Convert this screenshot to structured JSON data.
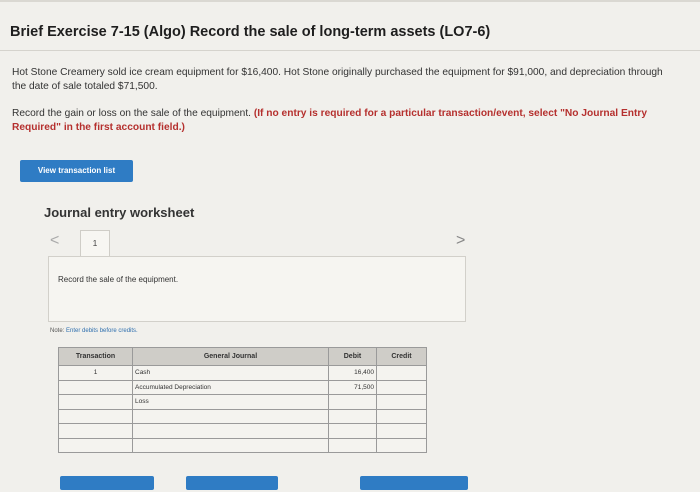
{
  "page": {
    "title": "Brief Exercise 7-15 (Algo) Record the sale of long-term assets (LO7-6)",
    "description": "Hot Stone Creamery sold ice cream equipment for $16,400. Hot Stone originally purchased the equipment for $91,000, and depreciation through the date of sale totaled $71,500.",
    "instruction_plain": "Record the gain or loss on the sale of the equipment. ",
    "instruction_bold": "(If no entry is required for a particular transaction/event, select \"No Journal Entry Required\" in the first account field.)"
  },
  "buttons": {
    "view_transaction_list": "View transaction list"
  },
  "worksheet": {
    "title": "Journal entry worksheet",
    "prev_arrow": "<",
    "next_arrow": ">",
    "current_tab": "1",
    "record_text": "Record the sale of the equipment.",
    "note_label": "Note:",
    "note_text": "Enter debits before credits."
  },
  "journal": {
    "headers": {
      "transaction": "Transaction",
      "general_journal": "General Journal",
      "debit": "Debit",
      "credit": "Credit"
    },
    "rows": [
      {
        "transaction": "1",
        "account": "Cash",
        "debit": "16,400",
        "credit": ""
      },
      {
        "transaction": "",
        "account": "Accumulated Depreciation",
        "debit": "71,500",
        "credit": ""
      },
      {
        "transaction": "",
        "account": "Loss",
        "debit": "",
        "credit": ""
      },
      {
        "transaction": "",
        "account": "",
        "debit": "",
        "credit": ""
      },
      {
        "transaction": "",
        "account": "",
        "debit": "",
        "credit": ""
      },
      {
        "transaction": "",
        "account": "",
        "debit": "",
        "credit": ""
      }
    ]
  },
  "colors": {
    "accent_blue": "#2f7cc4",
    "instruction_red": "#b5302e"
  }
}
